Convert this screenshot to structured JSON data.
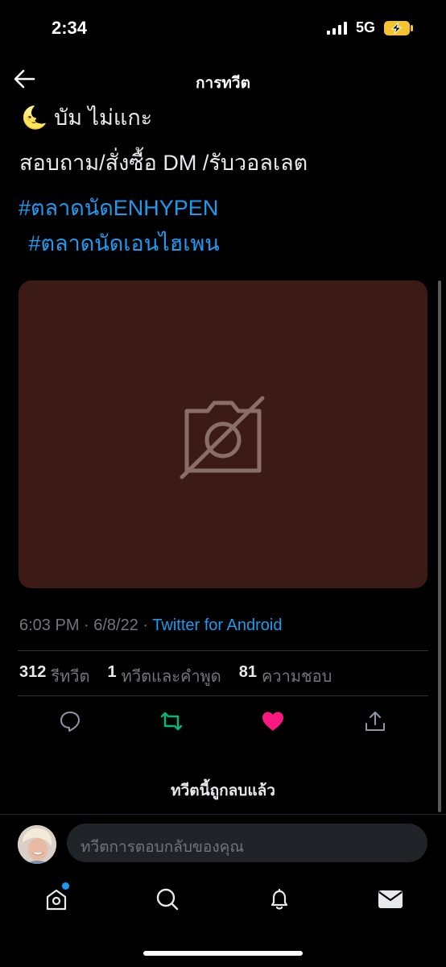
{
  "status_bar": {
    "time": "2:34",
    "network": "5G",
    "signal_icon": "signal-bars-icon",
    "battery_icon": "battery-charging-icon"
  },
  "header": {
    "title": "การทวีต",
    "back_icon": "back-arrow-icon"
  },
  "tweet": {
    "line1": "🌜 บัม ไม่แกะ",
    "line2": "สอบถาม/สั่งซื้อ DM /รับวอลเลต",
    "hashtag1": "#ตลาดนัดENHYPEN",
    "hashtag2": " #ตลาดนัดเอนไฮเพน",
    "media_icon": "media-unavailable-icon",
    "time_date": "6:03 PM · 6/8/22 · ",
    "source": "Twitter for Android",
    "retweets_count": "312",
    "retweets_label": "รีทวีต",
    "quotes_count": "1",
    "quotes_label": "ทวีตและคำพูด",
    "likes_count": "81",
    "likes_label": "ความชอบ"
  },
  "actions": {
    "reply_icon": "reply-icon",
    "retweet_icon": "retweet-icon",
    "like_icon": "heart-icon",
    "share_icon": "share-icon"
  },
  "deleted_notice": "ทวีตนี้ถูกลบแล้ว",
  "reply": {
    "placeholder": "ทวีตการตอบกลับของคุณ"
  },
  "bottom_nav": {
    "items": [
      "home-icon",
      "search-icon",
      "notifications-icon",
      "messages-icon"
    ]
  },
  "colors": {
    "accent": "#1d9bf0",
    "retweet_active": "#00ba7c",
    "like_active": "#f91880",
    "media_bg": "#3c1a15"
  }
}
